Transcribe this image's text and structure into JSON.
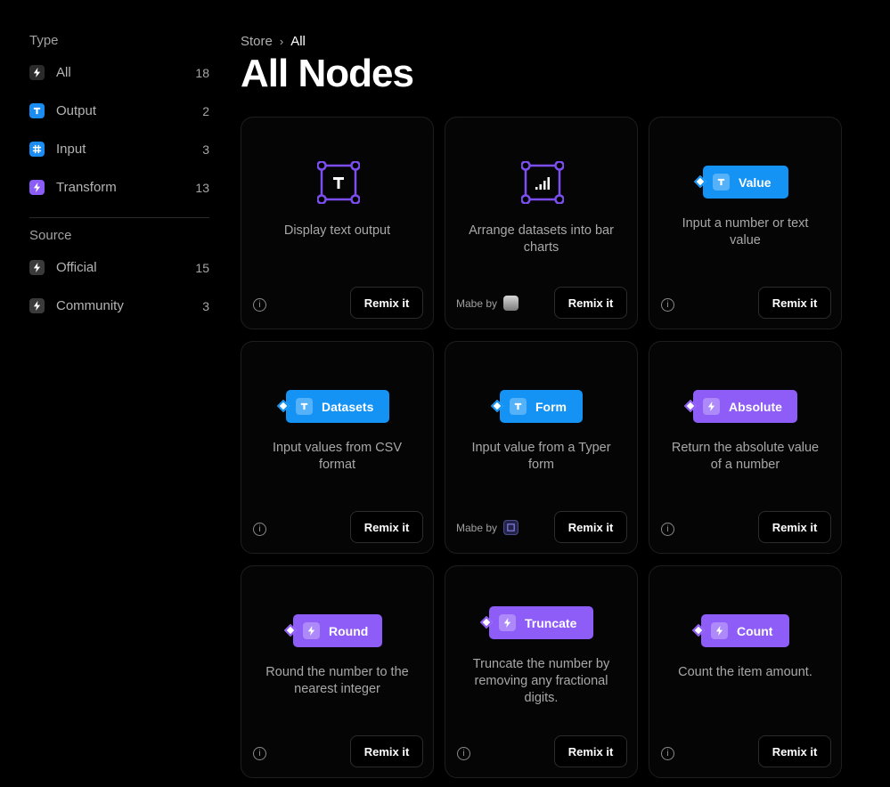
{
  "sidebar": {
    "type_heading": "Type",
    "type_items": [
      {
        "label": "All",
        "count": "18",
        "icon": "bolt-icon"
      },
      {
        "label": "Output",
        "count": "2",
        "icon": "text-icon"
      },
      {
        "label": "Input",
        "count": "3",
        "icon": "hash-icon"
      },
      {
        "label": "Transform",
        "count": "13",
        "icon": "bolt-icon"
      }
    ],
    "source_heading": "Source",
    "source_items": [
      {
        "label": "Official",
        "count": "15",
        "icon": "bolt-icon"
      },
      {
        "label": "Community",
        "count": "3",
        "icon": "bolt-icon"
      }
    ]
  },
  "breadcrumb": {
    "store": "Store",
    "separator": "›",
    "current": "All"
  },
  "page_title": "All Nodes",
  "cards": [
    {
      "description": "Display text output",
      "remix": "Remix it",
      "info": "i"
    },
    {
      "description": "Arrange datasets into bar charts",
      "remix": "Remix it",
      "made_by": "Mabe by"
    },
    {
      "pill": "Value",
      "description": "Input a number or text value",
      "remix": "Remix it",
      "info": "i"
    },
    {
      "pill": "Datasets",
      "description": "Input values from CSV format",
      "remix": "Remix it",
      "info": "i"
    },
    {
      "pill": "Form",
      "description": "Input value from a Typer form",
      "remix": "Remix it",
      "made_by": "Mabe by"
    },
    {
      "pill": "Absolute",
      "description": "Return the absolute value of a number",
      "remix": "Remix it",
      "info": "i"
    },
    {
      "pill": "Round",
      "description": "Round the number to the nearest integer",
      "remix": "Remix it",
      "info": "i"
    },
    {
      "pill": "Truncate",
      "description": "Truncate the number by removing any fractional digits.",
      "remix": "Remix it",
      "info": "i"
    },
    {
      "pill": "Count",
      "description": "Count the item amount.",
      "remix": "Remix it",
      "info": "i"
    }
  ],
  "colors": {
    "output_blue": "#1493f5",
    "transform_purple": "#8e5cf7",
    "frame_purple": "#7c4ef0"
  }
}
